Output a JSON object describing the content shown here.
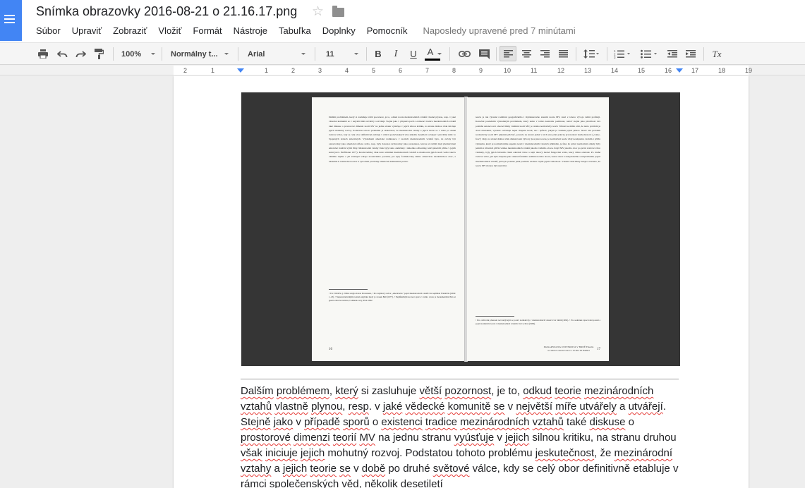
{
  "header": {
    "title": "Snímka obrazovky 2016-08-21 o 21.16.17.png",
    "star_glyph": "☆",
    "star_icon": "star-outline-icon",
    "folder_icon": "folder-icon",
    "app_icon": "google-docs-icon",
    "accent_color": "#4285f4"
  },
  "menu": {
    "items": [
      "Súbor",
      "Upraviť",
      "Zobraziť",
      "Vložiť",
      "Formát",
      "Nástroje",
      "Tabuľka",
      "Doplnky",
      "Pomocník"
    ],
    "last_edit": "Naposledy upravené pred 7 minútami"
  },
  "toolbar": {
    "zoom": "100%",
    "style": "Normálny t...",
    "font": "Arial",
    "size": "11",
    "bold": "B",
    "italic": "I",
    "underline": "U",
    "text_color": "A",
    "text_color_bar": "#000000",
    "clear_format": "Tx"
  },
  "ruler": {
    "labels": [
      "2",
      "1",
      "1",
      "2",
      "3",
      "4",
      "5",
      "6",
      "7",
      "8",
      "9",
      "10",
      "11",
      "12",
      "13",
      "14",
      "15",
      "16",
      "17",
      "18",
      "19"
    ]
  },
  "image": {
    "left_page": {
      "text": "Dalším problémem, který si zasluhuje větší pozornost, je to, odkud teorie mezinárodních vztahů vlastně plynou, resp. v jaké vědecké komunitě se v největší míře utvářely a utvářejí. Stejně jako v případě sporů o existenci tradice mezinárodních vztahů také diskuse o prostorové dimenzi teorií MV na jednu stranu vyúsťuje v jejich silnou kritiku, na stranu druhou však iniciuje jejich mohutný rozvoj. Podstatou tohoto problému je skutečnost, že mezinárodní vztahy a jejich teorie se v době po druhé světové válce, kdy se celý obor definitivně etabluje v rámci společenských věd, několik desetiletí rozvíjejí v převážné míře ve Spojených státech amerických. Výsledkem americké dominance v teoriích mezinárodních vztahů bylo, že začaly být označovány jako americká reflexe světa, resp. byly dokonce kritizovány jako prezentace, kterou si světští mají představitelé americké tradiční vyšší třídy. Mezinárodní vztahy však byly takto zaměřeny i několika odborníky, kteří působili přímo v jejich zemi (srov. Hoffmann 1977). Kromě kritiky však tento vnímání mezinárodních vztahů a ohodnocení jejich teorií vedlo také k většímu zájmu o již existující zdroje teoretického poznání, jež byly formulovány mimo americkou akademickou obec, a následně k rozmachu teorií a k vytvoření protiváhy americké dominantní pozice.",
      "footnotes": "¹ Tzv. WASPs, tj. White Anglo-Saxon Protestants, ² Pro zajímavý rozbor „amerického\" pojetí mezinárodních vztahů viz například Friedrichs (2004: 1–23). ³ Nejautoritativnějším textem anglické školy je svazek Bull (1977). ⁴ Nejdůležitější Aronova práce v tomto oboru je monumentální Paix et guerre entre les nations, Calmann-Lévy, Paris 1962.",
      "page_number": "16"
    },
    "right_page": {
      "text": "teorie je tak výrazně rozšíření geografického i myšlenkového zázemí teorie MV, kterí z tohoto vývoje velmi profitují. Konečně posledním významným problémem, který nelze v tomto kontextu pominout, neboť stejně jako předchozí dva pomáhá ustanovovat obecné limity vnímání teorií MV, je otázka normativity teorií. Trhnutí se může zdát, že tento problém je dosti abstraktní, výrazně ovlivňuje nejen chápání teorií, ale i způsob, jakým je vnímán jejich přínos. Navíc má problém normativity teorií MV pikantní příchuť, protože na straně jedné v nich sice platí princip prvotadosti bezhodnotové („value-free\") vědy, na straně druhou však diskutované výtvory jsou jako teorie, je normativní teorie vždy nenápadná. Jedním z příčin významu, který je normativnímu aspektu teorií v mezinárodních vztazích přikládán, je fakt, že právě normativní ohledy byly jedním z hlavních příčin vzniku mezinárodních vztahů jakožto vědního oboru. Když MV jakožto obor po první světové válce vznikaly, byly jejich hlavním cílem zabránit válce a najít takový model fungování světa, který válku odstraní. Po druhé světové válce, jež byla chápána jako doklad fatálního selhání nového oboru, nastal obrat k analytickému a empirickému pojetí mezinárodních vztahů, jež bylo posléze ještě posíleno snahou zvýšit jejich vědeckost. Vlastní však nikdy nebylo uvedeno, že teorie MV mohou být neutrální.",
      "footnotes": "⁵ Pro ověřování přesnosti tezí zabývající se pozicí normativity v mezinárodních vztazích viz Smith (1992). ⁶ Pro souhrnné zpracování pozadí a pojetí normativní teorie v mezinárodních vztazích viz Cochran (1999).",
      "stamp": "MASARYKOVA UNIVERZITA V BRNĚ Fakulta sociálních studií Joštova 10 602 00 BRNO",
      "page_number": "17"
    }
  },
  "body": {
    "segments": [
      {
        "t": "Dalším",
        "u": true
      },
      {
        "t": " ",
        "u": false
      },
      {
        "t": "problémem",
        "u": true
      },
      {
        "t": ", ",
        "u": false
      },
      {
        "t": "který",
        "u": true
      },
      {
        "t": " si zasluhuje ",
        "u": false
      },
      {
        "t": "větší",
        "u": true
      },
      {
        "t": " ",
        "u": false
      },
      {
        "t": "pozornost",
        "u": true
      },
      {
        "t": ", je to, ",
        "u": false
      },
      {
        "t": "odkud",
        "u": true
      },
      {
        "t": " ",
        "u": false
      },
      {
        "t": "teorie",
        "u": true
      },
      {
        "t": " ",
        "u": false
      },
      {
        "t": "mezinárodních",
        "u": true
      },
      {
        "t": " ",
        "u": false
      },
      {
        "t": "vztahů",
        "u": true
      },
      {
        "t": " ",
        "u": false
      },
      {
        "t": "vlastně",
        "u": true
      },
      {
        "t": " ",
        "u": false
      },
      {
        "t": "plynou",
        "u": true
      },
      {
        "t": ", ",
        "u": false
      },
      {
        "t": "resp",
        "u": true
      },
      {
        "t": ". v ",
        "u": false
      },
      {
        "t": "jaké",
        "u": true
      },
      {
        "t": " ",
        "u": false
      },
      {
        "t": "vědecké",
        "u": true
      },
      {
        "t": " ",
        "u": false
      },
      {
        "t": "komunitě",
        "u": true
      },
      {
        "t": " ",
        "u": false
      },
      {
        "t": "se",
        "u": true
      },
      {
        "t": " v ",
        "u": false
      },
      {
        "t": "největší",
        "u": true
      },
      {
        "t": " ",
        "u": false
      },
      {
        "t": "míře",
        "u": true
      },
      {
        "t": " ",
        "u": false
      },
      {
        "t": "utvářely",
        "u": true
      },
      {
        "t": " a ",
        "u": false
      },
      {
        "t": "utvářejí",
        "u": true
      },
      {
        "t": ". ",
        "u": false
      },
      {
        "t": "Stejně",
        "u": true
      },
      {
        "t": " ",
        "u": false
      },
      {
        "t": "jako",
        "u": true
      },
      {
        "t": " v ",
        "u": false
      },
      {
        "t": "případě",
        "u": true
      },
      {
        "t": " ",
        "u": false
      },
      {
        "t": "sporů",
        "u": true
      },
      {
        "t": " o ",
        "u": false
      },
      {
        "t": "existenci",
        "u": true
      },
      {
        "t": " ",
        "u": false
      },
      {
        "t": "tradice",
        "u": true
      },
      {
        "t": " ",
        "u": false
      },
      {
        "t": "mezinárodních",
        "u": true
      },
      {
        "t": " ",
        "u": false
      },
      {
        "t": "vztahů",
        "u": true
      },
      {
        "t": " také ",
        "u": false
      },
      {
        "t": "diskuse",
        "u": true
      },
      {
        "t": " o ",
        "u": false
      },
      {
        "t": "prostorové",
        "u": true
      },
      {
        "t": " ",
        "u": false
      },
      {
        "t": "dimenzi",
        "u": true
      },
      {
        "t": " ",
        "u": false
      },
      {
        "t": "teorií",
        "u": true
      },
      {
        "t": " ",
        "u": false
      },
      {
        "t": "MV",
        "u": true
      },
      {
        "t": " na jednu stranu ",
        "u": false
      },
      {
        "t": "vyúsťuje",
        "u": true
      },
      {
        "t": " v ",
        "u": false
      },
      {
        "t": "jejich",
        "u": true
      },
      {
        "t": " silnou kritiku, na stranu druhou ",
        "u": false
      },
      {
        "t": "však",
        "u": true
      },
      {
        "t": " ",
        "u": false
      },
      {
        "t": "iniciuje",
        "u": true
      },
      {
        "t": " ",
        "u": false
      },
      {
        "t": "jejich",
        "u": true
      },
      {
        "t": " mohutný rozvoj. Podstatou tohoto problému ",
        "u": false
      },
      {
        "t": "jeskutečnost",
        "u": true
      },
      {
        "t": ", že ",
        "u": false
      },
      {
        "t": "mezinárodní",
        "u": true
      },
      {
        "t": " ",
        "u": false
      },
      {
        "t": "vztahy",
        "u": true
      },
      {
        "t": " a ",
        "u": false
      },
      {
        "t": "jejich",
        "u": true
      },
      {
        "t": " ",
        "u": false
      },
      {
        "t": "teorie",
        "u": true
      },
      {
        "t": " ",
        "u": false
      },
      {
        "t": "se",
        "u": true
      },
      {
        "t": " v ",
        "u": false
      },
      {
        "t": "době",
        "u": true
      },
      {
        "t": " po druhé ",
        "u": false
      },
      {
        "t": "světové",
        "u": true
      },
      {
        "t": " válce, ",
        "u": false
      },
      {
        "t": "kdy se celý obor definitivně etabluje v rámci společenských věd, několik desetiletí",
        "u": false
      }
    ]
  }
}
